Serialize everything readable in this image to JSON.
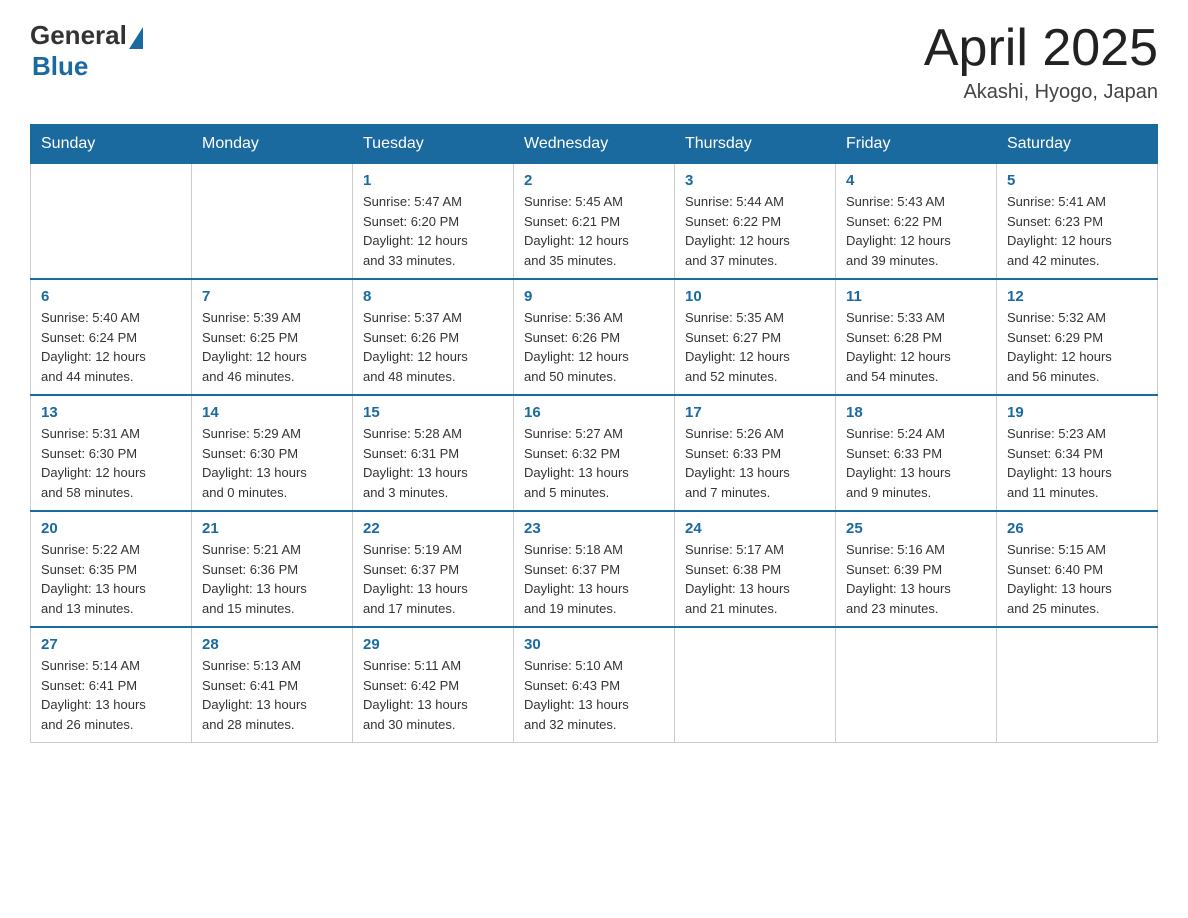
{
  "header": {
    "logo_general": "General",
    "logo_blue": "Blue",
    "title": "April 2025",
    "location": "Akashi, Hyogo, Japan"
  },
  "weekdays": [
    "Sunday",
    "Monday",
    "Tuesday",
    "Wednesday",
    "Thursday",
    "Friday",
    "Saturday"
  ],
  "weeks": [
    [
      {
        "day": "",
        "info": ""
      },
      {
        "day": "",
        "info": ""
      },
      {
        "day": "1",
        "info": "Sunrise: 5:47 AM\nSunset: 6:20 PM\nDaylight: 12 hours\nand 33 minutes."
      },
      {
        "day": "2",
        "info": "Sunrise: 5:45 AM\nSunset: 6:21 PM\nDaylight: 12 hours\nand 35 minutes."
      },
      {
        "day": "3",
        "info": "Sunrise: 5:44 AM\nSunset: 6:22 PM\nDaylight: 12 hours\nand 37 minutes."
      },
      {
        "day": "4",
        "info": "Sunrise: 5:43 AM\nSunset: 6:22 PM\nDaylight: 12 hours\nand 39 minutes."
      },
      {
        "day": "5",
        "info": "Sunrise: 5:41 AM\nSunset: 6:23 PM\nDaylight: 12 hours\nand 42 minutes."
      }
    ],
    [
      {
        "day": "6",
        "info": "Sunrise: 5:40 AM\nSunset: 6:24 PM\nDaylight: 12 hours\nand 44 minutes."
      },
      {
        "day": "7",
        "info": "Sunrise: 5:39 AM\nSunset: 6:25 PM\nDaylight: 12 hours\nand 46 minutes."
      },
      {
        "day": "8",
        "info": "Sunrise: 5:37 AM\nSunset: 6:26 PM\nDaylight: 12 hours\nand 48 minutes."
      },
      {
        "day": "9",
        "info": "Sunrise: 5:36 AM\nSunset: 6:26 PM\nDaylight: 12 hours\nand 50 minutes."
      },
      {
        "day": "10",
        "info": "Sunrise: 5:35 AM\nSunset: 6:27 PM\nDaylight: 12 hours\nand 52 minutes."
      },
      {
        "day": "11",
        "info": "Sunrise: 5:33 AM\nSunset: 6:28 PM\nDaylight: 12 hours\nand 54 minutes."
      },
      {
        "day": "12",
        "info": "Sunrise: 5:32 AM\nSunset: 6:29 PM\nDaylight: 12 hours\nand 56 minutes."
      }
    ],
    [
      {
        "day": "13",
        "info": "Sunrise: 5:31 AM\nSunset: 6:30 PM\nDaylight: 12 hours\nand 58 minutes."
      },
      {
        "day": "14",
        "info": "Sunrise: 5:29 AM\nSunset: 6:30 PM\nDaylight: 13 hours\nand 0 minutes."
      },
      {
        "day": "15",
        "info": "Sunrise: 5:28 AM\nSunset: 6:31 PM\nDaylight: 13 hours\nand 3 minutes."
      },
      {
        "day": "16",
        "info": "Sunrise: 5:27 AM\nSunset: 6:32 PM\nDaylight: 13 hours\nand 5 minutes."
      },
      {
        "day": "17",
        "info": "Sunrise: 5:26 AM\nSunset: 6:33 PM\nDaylight: 13 hours\nand 7 minutes."
      },
      {
        "day": "18",
        "info": "Sunrise: 5:24 AM\nSunset: 6:33 PM\nDaylight: 13 hours\nand 9 minutes."
      },
      {
        "day": "19",
        "info": "Sunrise: 5:23 AM\nSunset: 6:34 PM\nDaylight: 13 hours\nand 11 minutes."
      }
    ],
    [
      {
        "day": "20",
        "info": "Sunrise: 5:22 AM\nSunset: 6:35 PM\nDaylight: 13 hours\nand 13 minutes."
      },
      {
        "day": "21",
        "info": "Sunrise: 5:21 AM\nSunset: 6:36 PM\nDaylight: 13 hours\nand 15 minutes."
      },
      {
        "day": "22",
        "info": "Sunrise: 5:19 AM\nSunset: 6:37 PM\nDaylight: 13 hours\nand 17 minutes."
      },
      {
        "day": "23",
        "info": "Sunrise: 5:18 AM\nSunset: 6:37 PM\nDaylight: 13 hours\nand 19 minutes."
      },
      {
        "day": "24",
        "info": "Sunrise: 5:17 AM\nSunset: 6:38 PM\nDaylight: 13 hours\nand 21 minutes."
      },
      {
        "day": "25",
        "info": "Sunrise: 5:16 AM\nSunset: 6:39 PM\nDaylight: 13 hours\nand 23 minutes."
      },
      {
        "day": "26",
        "info": "Sunrise: 5:15 AM\nSunset: 6:40 PM\nDaylight: 13 hours\nand 25 minutes."
      }
    ],
    [
      {
        "day": "27",
        "info": "Sunrise: 5:14 AM\nSunset: 6:41 PM\nDaylight: 13 hours\nand 26 minutes."
      },
      {
        "day": "28",
        "info": "Sunrise: 5:13 AM\nSunset: 6:41 PM\nDaylight: 13 hours\nand 28 minutes."
      },
      {
        "day": "29",
        "info": "Sunrise: 5:11 AM\nSunset: 6:42 PM\nDaylight: 13 hours\nand 30 minutes."
      },
      {
        "day": "30",
        "info": "Sunrise: 5:10 AM\nSunset: 6:43 PM\nDaylight: 13 hours\nand 32 minutes."
      },
      {
        "day": "",
        "info": ""
      },
      {
        "day": "",
        "info": ""
      },
      {
        "day": "",
        "info": ""
      }
    ]
  ]
}
